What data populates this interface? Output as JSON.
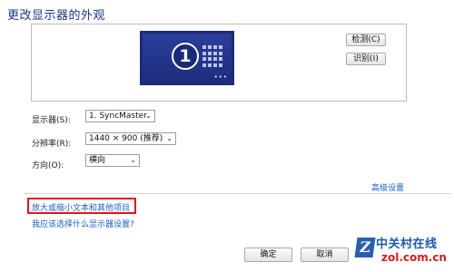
{
  "page": {
    "title": "更改显示器的外观"
  },
  "preview": {
    "monitor_number": "1",
    "monitor_dots": "•••",
    "detect_label": "检测(C)",
    "identify_label": "识别(I)"
  },
  "settings": {
    "display_label": "显示器(S):",
    "display_value": "1. SyncMaster",
    "resolution_label": "分辨率(R):",
    "resolution_value": "1440 × 900 (推荐)",
    "orientation_label": "方向(O):",
    "orientation_value": "横向"
  },
  "links": {
    "advanced": "高级设置",
    "enlarge_text": "放大或缩小文本和其他项目",
    "help": "我应该选择什么显示器设置?"
  },
  "footer": {
    "ok_label": "确定",
    "cancel_label": "取消"
  },
  "watermark": {
    "logo_letter": "Z",
    "site_name": "中关村在线",
    "domain": "zol.com.cn"
  },
  "colors": {
    "title": "#1e3287",
    "link": "#1a5fc3",
    "highlight": "#e3131b",
    "monitor": "#1c2b73"
  }
}
